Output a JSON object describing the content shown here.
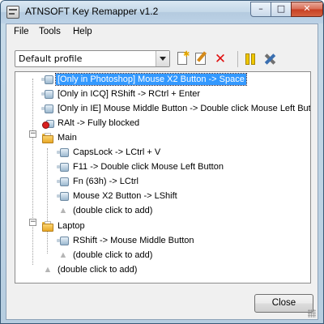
{
  "window": {
    "title": "ATNSOFT Key Remapper v1.2",
    "caption_buttons": {
      "minimize": "–",
      "maximize": "□",
      "close": "✕"
    }
  },
  "menu": {
    "items": [
      "File",
      "Tools",
      "Help"
    ]
  },
  "toolbar": {
    "profile_value": "Default profile",
    "buttons": [
      {
        "name": "new-icon"
      },
      {
        "name": "edit-icon"
      },
      {
        "name": "delete-icon"
      },
      {
        "name": "pause-icon"
      },
      {
        "name": "settings-icon"
      }
    ]
  },
  "tree": {
    "items": [
      {
        "label": "[Only in Photoshop] Mouse X2 Button -> Space",
        "icon": "key-icon",
        "selected": true
      },
      {
        "label": "[Only in ICQ] RShift -> RCtrl + Enter",
        "icon": "key-icon"
      },
      {
        "label": "[Only in IE] Mouse Middle Button -> Double click Mouse Left Button",
        "icon": "key-icon"
      },
      {
        "label": "RAlt -> Fully blocked",
        "icon": "blocked-key-icon"
      },
      {
        "label": "Main",
        "icon": "folder-icon",
        "expanded": true
      },
      {
        "label": "CapsLock -> LCtrl + V",
        "icon": "key-icon"
      },
      {
        "label": "F11 -> Double click Mouse Left Button",
        "icon": "key-icon"
      },
      {
        "label": "Fn (63h) -> LCtrl",
        "icon": "key-icon"
      },
      {
        "label": "Mouse X2 Button -> LShift",
        "icon": "key-icon"
      },
      {
        "label": "(double click to add)",
        "icon": "add-icon"
      },
      {
        "label": "Laptop",
        "icon": "folder-icon",
        "expanded": true
      },
      {
        "label": "RShift -> Mouse Middle Button",
        "icon": "key-icon"
      },
      {
        "label": "(double click to add)",
        "icon": "add-icon"
      },
      {
        "label": "(double click to add)",
        "icon": "add-icon"
      }
    ],
    "expander_symbol": "−"
  },
  "footer": {
    "close_label": "Close"
  },
  "colors": {
    "selection": "#3399ff",
    "title_bar": "#c3d7e8",
    "close_caption": "#c73e22"
  }
}
